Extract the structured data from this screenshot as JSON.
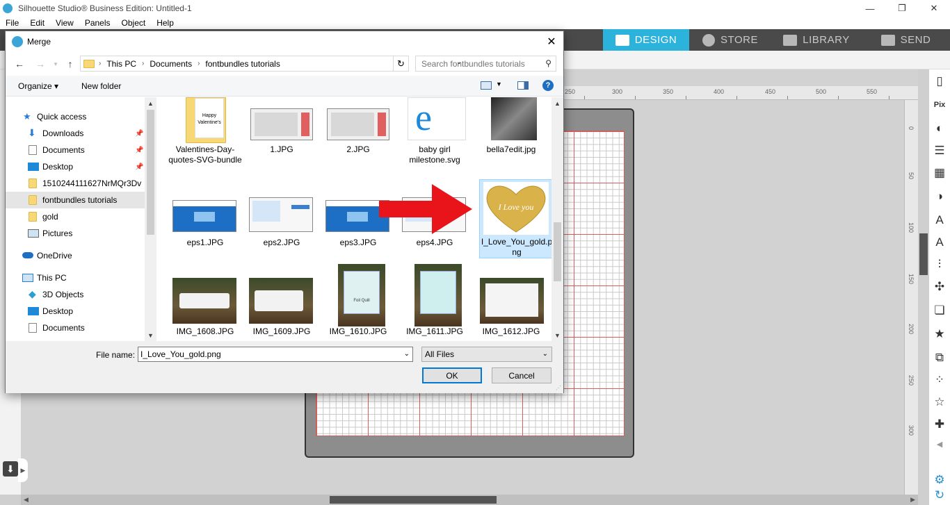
{
  "app": {
    "title": "Silhouette Studio® Business Edition: Untitled-1",
    "menu": [
      "File",
      "Edit",
      "View",
      "Panels",
      "Object",
      "Help"
    ],
    "window_controls": {
      "minimize": "—",
      "restore": "❐",
      "close": "✕"
    }
  },
  "tabs": [
    {
      "label": "DESIGN",
      "active": true,
      "icon": "grid-icon"
    },
    {
      "label": "STORE",
      "active": false,
      "icon": "store-icon"
    },
    {
      "label": "LIBRARY",
      "active": false,
      "icon": "library-icon"
    },
    {
      "label": "SEND",
      "active": false,
      "icon": "send-icon"
    }
  ],
  "ruler": {
    "top_ticks": [
      "250",
      "300",
      "350",
      "400",
      "450",
      "500",
      "550"
    ],
    "right_ticks": [
      "0",
      "50",
      "100",
      "150",
      "200",
      "250",
      "300"
    ]
  },
  "dialog": {
    "title": "Merge",
    "close": "✕",
    "nav": {
      "back": "←",
      "forward": "→",
      "up": "↑"
    },
    "breadcrumb": [
      "This PC",
      "Documents",
      "fontbundles tutorials"
    ],
    "search_placeholder": "Search fontbundles tutorials",
    "commands": {
      "organize": "Organize ▾",
      "new_folder": "New folder"
    },
    "nav_items": [
      {
        "label": "Quick access",
        "icon": "star-icon",
        "pinned": false,
        "selected": false
      },
      {
        "label": "Downloads",
        "icon": "download-icon",
        "pinned": true,
        "selected": false
      },
      {
        "label": "Documents",
        "icon": "document-icon",
        "pinned": true,
        "selected": false
      },
      {
        "label": "Desktop",
        "icon": "desktop-icon",
        "pinned": true,
        "selected": false
      },
      {
        "label": "1510244111627NrMQr3Dv",
        "icon": "folder-icon",
        "pinned": false,
        "selected": false
      },
      {
        "label": "fontbundles tutorials",
        "icon": "folder-icon",
        "pinned": false,
        "selected": true
      },
      {
        "label": "gold",
        "icon": "folder-icon",
        "pinned": false,
        "selected": false
      },
      {
        "label": "Pictures",
        "icon": "pictures-icon",
        "pinned": false,
        "selected": false
      },
      {
        "label": "OneDrive",
        "icon": "cloud-icon",
        "pinned": false,
        "selected": false
      },
      {
        "label": "This PC",
        "icon": "computer-icon",
        "pinned": false,
        "selected": false
      },
      {
        "label": "3D Objects",
        "icon": "cube-icon",
        "pinned": false,
        "selected": false
      },
      {
        "label": "Desktop",
        "icon": "desktop-icon",
        "pinned": false,
        "selected": false
      },
      {
        "label": "Documents",
        "icon": "document-icon",
        "pinned": false,
        "selected": false
      }
    ],
    "files": [
      {
        "name": "Valentines-Day-quotes-SVG-bundle",
        "kind": "folder"
      },
      {
        "name": "1.JPG",
        "kind": "screenshot"
      },
      {
        "name": "2.JPG",
        "kind": "screenshot"
      },
      {
        "name": "baby girl milestone.svg",
        "kind": "ie-icon"
      },
      {
        "name": "bella7edit.jpg",
        "kind": "photo-bw"
      },
      {
        "name": "eps1.JPG",
        "kind": "web-blue"
      },
      {
        "name": "eps2.JPG",
        "kind": "web-white"
      },
      {
        "name": "eps3.JPG",
        "kind": "web-blue"
      },
      {
        "name": "eps4.JPG",
        "kind": "web-white"
      },
      {
        "name": "I_Love_You_gold.png",
        "kind": "gold-heart",
        "selected": true
      },
      {
        "name": "IMG_1608.JPG",
        "kind": "machine-photo"
      },
      {
        "name": "IMG_1609.JPG",
        "kind": "machine-photo"
      },
      {
        "name": "IMG_1610.JPG",
        "kind": "product-photo"
      },
      {
        "name": "IMG_1611.JPG",
        "kind": "product-photo"
      },
      {
        "name": "IMG_1612.JPG",
        "kind": "product-photo"
      }
    ],
    "file_name_label": "File name:",
    "file_name_value": "I_Love_You_gold.png",
    "file_type": "All Files",
    "ok": "OK",
    "cancel": "Cancel"
  },
  "heart_text": "I Love you",
  "thumb_text": {
    "valentines_card": "Happy Valentine's",
    "product_box": "Foil Quill"
  },
  "colors": {
    "accent": "#2bb3dc",
    "tabbar": "#4a4a4a",
    "selection": "#cce8ff",
    "arrow": "#e8141a"
  }
}
